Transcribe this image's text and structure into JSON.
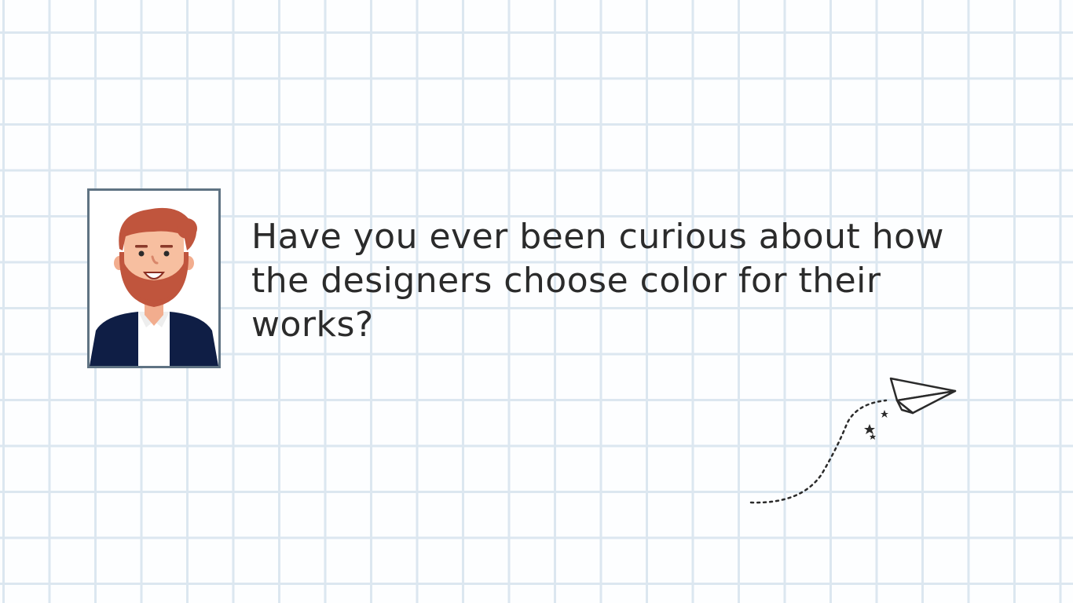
{
  "headline": {
    "text": "Have you ever been curious about how the designers choose color for their works?"
  },
  "colors": {
    "grid_line": "#dce7f0",
    "frame_border": "#5f7383",
    "text": "#2b2b2b",
    "hair": "#c0553d",
    "skin": "#f7bfa0",
    "jacket": "#0f1e45",
    "shirt": "#ffffff"
  },
  "icons": {
    "portrait": "person-avatar-icon",
    "plane": "paper-plane-icon"
  }
}
